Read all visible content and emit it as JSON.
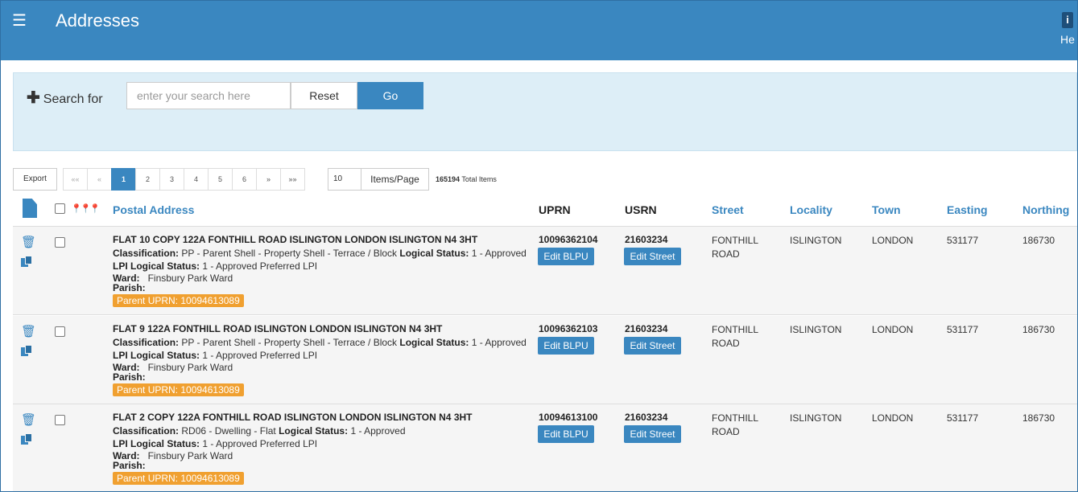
{
  "header": {
    "menu_icon": "☰",
    "title": "Addresses",
    "help_icon": "i",
    "help_label": "He"
  },
  "search": {
    "label": "Search for",
    "placeholder": "enter your search here",
    "reset_label": "Reset",
    "go_label": "Go"
  },
  "toolbar": {
    "export_label": "Export",
    "pages": [
      "««",
      "«",
      "1",
      "2",
      "3",
      "4",
      "5",
      "6",
      "»",
      "»»"
    ],
    "current_page": "1",
    "items_per_page": "10",
    "items_per_page_label": "Items/Page",
    "total_count": "165194",
    "total_label": "Total Items"
  },
  "columns": {
    "postal_address": "Postal Address",
    "uprn": "UPRN",
    "usrn": "USRN",
    "street": "Street",
    "locality": "Locality",
    "town": "Town",
    "easting": "Easting",
    "northing": "Northing"
  },
  "labels": {
    "classification": "Classification:",
    "logical_status": "Logical Status:",
    "lpi_logical_status": "LPI Logical Status:",
    "ward": "Ward:",
    "parish": "Parish:",
    "edit_blpu": "Edit BLPU",
    "edit_street": "Edit Street"
  },
  "rows": [
    {
      "address": "FLAT 10 COPY 122A FONTHILL ROAD ISLINGTON LONDON ISLINGTON N4 3HT",
      "classification": "PP - Parent Shell - Property Shell - Terrace / Block",
      "logical_status": "1 - Approved",
      "lpi_logical_status": "1 - Approved Preferred LPI",
      "ward": "Finsbury Park Ward",
      "parish": "",
      "parent_uprn": "Parent UPRN: 10094613089",
      "uprn": "10096362104",
      "usrn": "21603234",
      "street_1": "FONTHILL",
      "street_2": "ROAD",
      "locality": "ISLINGTON",
      "town": "LONDON",
      "easting": "531177",
      "northing": "186730"
    },
    {
      "address": "FLAT 9 122A FONTHILL ROAD ISLINGTON LONDON ISLINGTON N4 3HT",
      "classification": "PP - Parent Shell - Property Shell - Terrace / Block",
      "logical_status": "1 - Approved",
      "lpi_logical_status": "1 - Approved Preferred LPI",
      "ward": "Finsbury Park Ward",
      "parish": "",
      "parent_uprn": "Parent UPRN: 10094613089",
      "uprn": "10096362103",
      "usrn": "21603234",
      "street_1": "FONTHILL",
      "street_2": "ROAD",
      "locality": "ISLINGTON",
      "town": "LONDON",
      "easting": "531177",
      "northing": "186730"
    },
    {
      "address": "FLAT 2 COPY 122A FONTHILL ROAD ISLINGTON LONDON ISLINGTON N4 3HT",
      "classification": "RD06 - Dwelling - Flat",
      "logical_status": "1 - Approved",
      "lpi_logical_status": "1 - Approved Preferred LPI",
      "ward": "Finsbury Park Ward",
      "parish": "",
      "parent_uprn": "Parent UPRN: 10094613089",
      "uprn": "10094613100",
      "usrn": "21603234",
      "street_1": "FONTHILL",
      "street_2": "ROAD",
      "locality": "ISLINGTON",
      "town": "LONDON",
      "easting": "531177",
      "northing": "186730"
    }
  ]
}
